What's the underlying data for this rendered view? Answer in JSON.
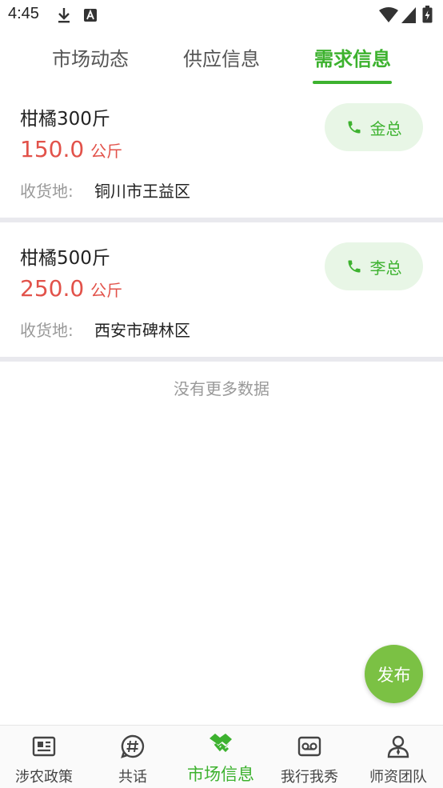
{
  "status_bar": {
    "time": "4:45"
  },
  "tabs": [
    {
      "label": "市场动态"
    },
    {
      "label": "供应信息"
    },
    {
      "label": "需求信息"
    }
  ],
  "active_tab": "需求信息",
  "listings": [
    {
      "title": "柑橘300斤",
      "price": "150.0",
      "unit": "公斤",
      "address_label": "收货地:",
      "address": "铜川市王益区",
      "contact": "金总"
    },
    {
      "title": "柑橘500斤",
      "price": "250.0",
      "unit": "公斤",
      "address_label": "收货地:",
      "address": "西安市碑林区",
      "contact": "李总"
    }
  ],
  "no_more_text": "没有更多数据",
  "fab_label": "发布",
  "bottom_nav": [
    {
      "label": "涉农政策",
      "icon": "newspaper-icon"
    },
    {
      "label": "共话",
      "icon": "hashtag-chat-icon"
    },
    {
      "label": "市场信息",
      "icon": "handshake-icon"
    },
    {
      "label": "我行我秀",
      "icon": "voicemail-icon"
    },
    {
      "label": "师资团队",
      "icon": "person-icon"
    }
  ],
  "colors": {
    "accent": "#3db22f",
    "price": "#e2524a",
    "fab": "#7bc144",
    "chip_bg": "#e8f6e6"
  }
}
